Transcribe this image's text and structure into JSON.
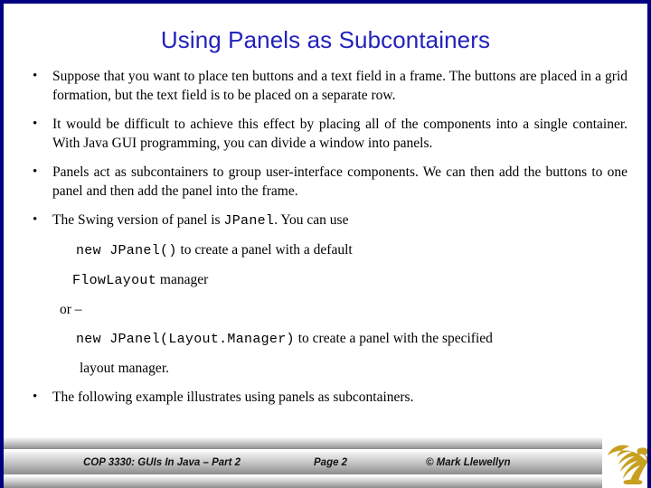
{
  "slide": {
    "title": "Using Panels as Subcontainers",
    "title_color": "#2222bb",
    "border_color": "#000080",
    "background": "#ffffff"
  },
  "bullets": [
    {
      "marker": "•",
      "text": "Suppose that you want to place ten buttons and a text field in a frame.  The buttons are placed in a grid formation, but the text field is to be placed on a separate row."
    },
    {
      "marker": "•",
      "text": "It would be difficult to achieve this effect by placing all of the components into a single container.   With Java GUI programming, you can divide a window into panels."
    },
    {
      "marker": "•",
      "text": "Panels act as subcontainers to group user-interface components.  We can then add the buttons to one panel and then add the panel into the frame."
    }
  ],
  "swing_bullet": {
    "marker": "•",
    "part1": "The Swing version of panel is ",
    "code1": "JPanel",
    "part2": ".  You can use"
  },
  "code_lines": {
    "line1_code": "new JPanel()",
    "line1_text": " to create a panel with a default",
    "line2_code": "FlowLayout",
    "line2_text": " manager",
    "or_text": "or –",
    "line3_code": "new JPanel(Layout.Manager)",
    "line3_text": " to create a panel with the specified",
    "line4_text": "layout manager."
  },
  "last_bullet": {
    "marker": "•",
    "text": "The following example illustrates using panels as subcontainers."
  },
  "footer": {
    "course": "COP 3330:  GUIs In Java – Part 2",
    "page": "Page 2",
    "copyright": "© Mark Llewellyn",
    "logo_color": "#c8a020",
    "logo_name": "ucf-pegasus-logo"
  }
}
